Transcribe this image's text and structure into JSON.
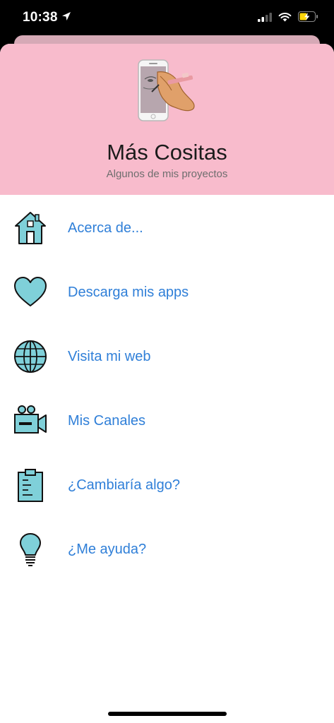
{
  "status_bar": {
    "time": "10:38"
  },
  "header": {
    "title": "Más Cositas",
    "subtitle": "Algunos de mis proyectos"
  },
  "menu": {
    "items": [
      {
        "label": "Acerca de...",
        "icon": "house-icon"
      },
      {
        "label": "Descarga mis apps",
        "icon": "heart-icon"
      },
      {
        "label": "Visita mi web",
        "icon": "globe-icon"
      },
      {
        "label": "Mis Canales",
        "icon": "video-camera-icon"
      },
      {
        "label": "¿Cambiaría algo?",
        "icon": "clipboard-icon"
      },
      {
        "label": "¿Me ayuda?",
        "icon": "lightbulb-icon"
      }
    ]
  },
  "colors": {
    "header_bg": "#f8bbcc",
    "icon_fill": "#7fd0d9",
    "link": "#2f7fd8",
    "battery": "#ffd60a"
  }
}
